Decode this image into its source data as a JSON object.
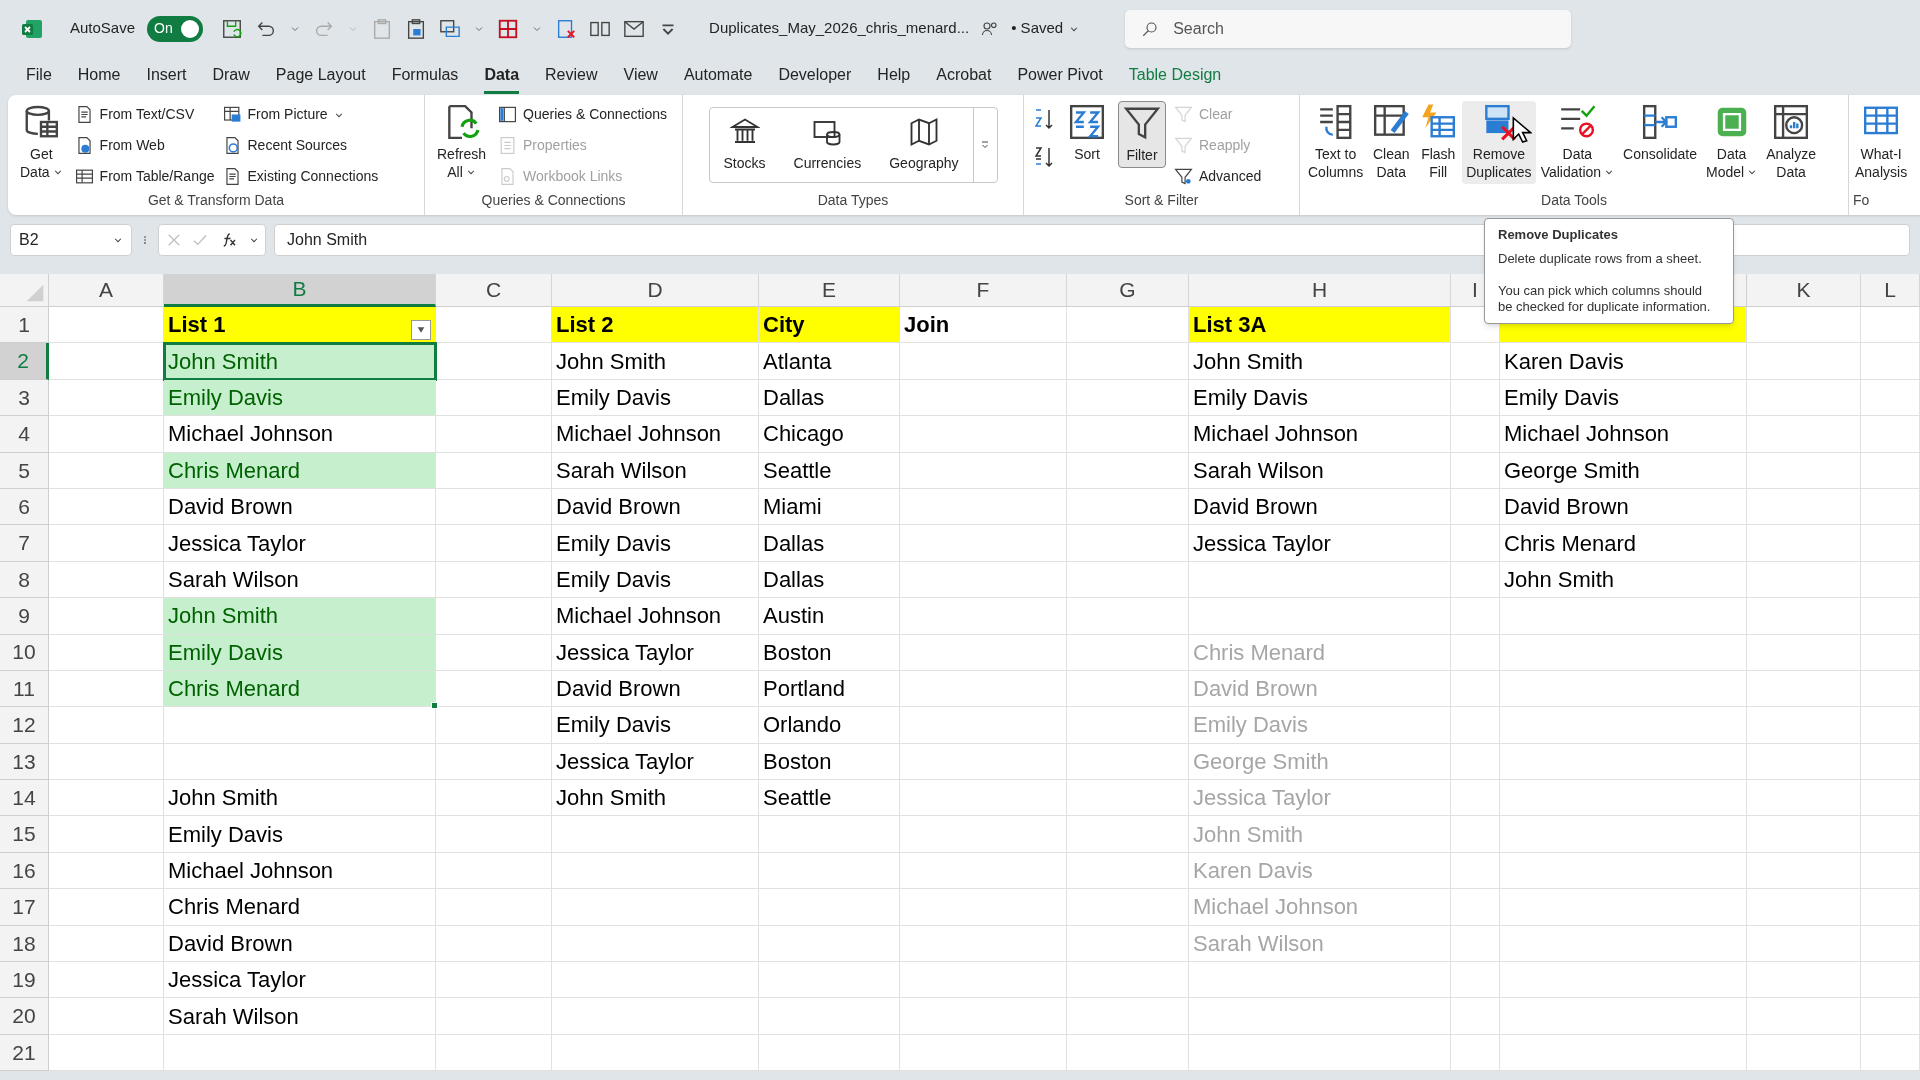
{
  "title_bar": {
    "autosave_label": "AutoSave",
    "autosave": {
      "on": true,
      "text": "On"
    },
    "filename": "Duplicates_May_2026_chris_menard...",
    "save_status": "• Saved",
    "search": {
      "placeholder": "Search"
    }
  },
  "menu_tabs": [
    {
      "label": "File",
      "selected": false,
      "kind": "normal"
    },
    {
      "label": "Home",
      "selected": false,
      "kind": "normal"
    },
    {
      "label": "Insert",
      "selected": false,
      "kind": "normal"
    },
    {
      "label": "Draw",
      "selected": false,
      "kind": "normal"
    },
    {
      "label": "Page Layout",
      "selected": false,
      "kind": "normal"
    },
    {
      "label": "Formulas",
      "selected": false,
      "kind": "normal"
    },
    {
      "label": "Data",
      "selected": true,
      "kind": "normal"
    },
    {
      "label": "Review",
      "selected": false,
      "kind": "normal"
    },
    {
      "label": "View",
      "selected": false,
      "kind": "normal"
    },
    {
      "label": "Automate",
      "selected": false,
      "kind": "normal"
    },
    {
      "label": "Developer",
      "selected": false,
      "kind": "normal"
    },
    {
      "label": "Help",
      "selected": false,
      "kind": "normal"
    },
    {
      "label": "Acrobat",
      "selected": false,
      "kind": "normal"
    },
    {
      "label": "Power Pivot",
      "selected": false,
      "kind": "normal"
    },
    {
      "label": "Table Design",
      "selected": false,
      "kind": "contextual"
    }
  ],
  "ribbon_groups": [
    {
      "label": "Get & Transform Data",
      "items": [
        {
          "kind": "large",
          "lines": [
            "Get",
            "Data"
          ],
          "dropdown": true,
          "disabled": false,
          "pressed": false
        },
        {
          "kind": "small_column",
          "items": [
            {
              "label": "From Text/CSV",
              "disabled": false,
              "dropdown": false
            },
            {
              "label": "From Web",
              "disabled": false,
              "dropdown": false
            },
            {
              "label": "From Table/Range",
              "disabled": false,
              "dropdown": false
            }
          ]
        },
        {
          "kind": "small_column",
          "items": [
            {
              "label": "From Picture",
              "disabled": false,
              "dropdown": true
            },
            {
              "label": "Recent Sources",
              "disabled": false,
              "dropdown": false
            },
            {
              "label": "Existing Connections",
              "disabled": false,
              "dropdown": false
            }
          ]
        }
      ]
    },
    {
      "label": "Queries & Connections",
      "items": [
        {
          "kind": "large",
          "lines": [
            "Refresh",
            "All"
          ],
          "dropdown": true,
          "disabled": false,
          "pressed": false
        },
        {
          "kind": "small_column",
          "items": [
            {
              "label": "Queries & Connections",
              "disabled": false,
              "dropdown": false
            },
            {
              "label": "Properties",
              "disabled": true,
              "dropdown": false
            },
            {
              "label": "Workbook Links",
              "disabled": true,
              "dropdown": false
            }
          ]
        }
      ]
    },
    {
      "label": "Data Types",
      "items": [
        {
          "kind": "gallery",
          "items": [
            {
              "label": "Stocks"
            },
            {
              "label": "Currencies"
            },
            {
              "label": "Geography"
            }
          ]
        }
      ]
    },
    {
      "label": "Sort & Filter",
      "items": [
        {
          "kind": "sort_buttons"
        },
        {
          "kind": "large",
          "lines": [
            "Sort"
          ],
          "dropdown": false,
          "disabled": false,
          "pressed": false
        },
        {
          "kind": "large",
          "lines": [
            "Filter"
          ],
          "dropdown": false,
          "disabled": false,
          "pressed": true
        },
        {
          "kind": "small_column",
          "items": [
            {
              "label": "Clear",
              "disabled": true,
              "dropdown": false
            },
            {
              "label": "Reapply",
              "disabled": true,
              "dropdown": false
            },
            {
              "label": "Advanced",
              "disabled": false,
              "dropdown": false
            }
          ]
        }
      ]
    },
    {
      "label": "Data Tools",
      "items": [
        {
          "kind": "large",
          "lines": [
            "Text to",
            "Columns"
          ],
          "dropdown": false,
          "disabled": false,
          "pressed": false
        },
        {
          "kind": "large",
          "lines": [
            "Clean",
            "Data"
          ],
          "dropdown": false,
          "disabled": false,
          "pressed": false
        },
        {
          "kind": "large",
          "lines": [
            "Flash",
            "Fill"
          ],
          "dropdown": false,
          "disabled": false,
          "pressed": false
        },
        {
          "kind": "large",
          "lines": [
            "Remove",
            "Duplicates"
          ],
          "dropdown": false,
          "disabled": false,
          "pressed": false,
          "hovered": true
        },
        {
          "kind": "large",
          "lines": [
            "Data",
            "Validation"
          ],
          "dropdown": true,
          "disabled": false,
          "pressed": false
        },
        {
          "kind": "large",
          "lines": [
            "Consolidate"
          ],
          "dropdown": false,
          "disabled": false,
          "pressed": false
        },
        {
          "kind": "large",
          "lines": [
            "Data",
            "Model"
          ],
          "dropdown": true,
          "disabled": false,
          "pressed": false
        },
        {
          "kind": "large",
          "lines": [
            "Analyze",
            "Data"
          ],
          "dropdown": false,
          "disabled": false,
          "pressed": false
        }
      ]
    },
    {
      "label": "Fo",
      "items": [
        {
          "kind": "large",
          "lines": [
            "What-I",
            "Analysis"
          ],
          "dropdown": false,
          "disabled": false,
          "pressed": false
        }
      ]
    }
  ],
  "formula_bar": {
    "name_box": "B2",
    "formula": "John Smith"
  },
  "tooltip": {
    "title": "Remove Duplicates",
    "text": "Delete duplicate rows from a sheet.",
    "detail": "You can pick which columns should be checked for duplicate information."
  },
  "sheet": {
    "columns": [
      {
        "label": "A",
        "selected": false
      },
      {
        "label": "B",
        "selected": true
      },
      {
        "label": "C",
        "selected": false
      },
      {
        "label": "D",
        "selected": false
      },
      {
        "label": "E",
        "selected": false
      },
      {
        "label": "F",
        "selected": false
      },
      {
        "label": "G",
        "selected": false
      },
      {
        "label": "H",
        "selected": false
      },
      {
        "label": "I",
        "selected": false
      },
      "",
      {
        "label": "K",
        "selected": false
      },
      {
        "label": "L",
        "selected": false
      }
    ],
    "rows": [
      {
        "number": "1",
        "selected": false,
        "cells": [
          "",
          {
            "text": "List 1",
            "kind": "header",
            "filter_button": true
          },
          "",
          {
            "text": "List 2",
            "kind": "header"
          },
          {
            "text": "City",
            "kind": "header"
          },
          {
            "text": "Join",
            "kind": "bold"
          },
          "",
          {
            "text": "List 3A",
            "kind": "header"
          },
          "",
          {
            "kind": "header"
          }
        ]
      },
      {
        "number": "2",
        "selected": true,
        "cells": [
          "",
          {
            "text": "John Smith",
            "kind": "highlight"
          },
          "",
          {
            "text": "John Smith",
            "kind": "plain"
          },
          {
            "text": "Atlanta",
            "kind": "plain"
          },
          "",
          "",
          {
            "text": "John Smith",
            "kind": "plain"
          },
          "",
          {
            "text": "Karen Davis",
            "kind": "plain"
          }
        ]
      },
      {
        "number": "3",
        "selected": false,
        "cells": [
          "",
          {
            "text": "Emily Davis",
            "kind": "highlight"
          },
          "",
          {
            "text": "Emily Davis",
            "kind": "plain"
          },
          {
            "text": "Dallas",
            "kind": "plain"
          },
          "",
          "",
          {
            "text": "Emily Davis",
            "kind": "plain"
          },
          "",
          {
            "text": "Emily Davis",
            "kind": "plain"
          }
        ]
      },
      {
        "number": "4",
        "selected": false,
        "cells": [
          "",
          {
            "text": "Michael Johnson",
            "kind": "plain"
          },
          "",
          {
            "text": "Michael Johnson",
            "kind": "plain"
          },
          {
            "text": "Chicago",
            "kind": "plain"
          },
          "",
          "",
          {
            "text": "Michael Johnson",
            "kind": "plain"
          },
          "",
          {
            "text": "Michael Johnson",
            "kind": "plain"
          }
        ]
      },
      {
        "number": "5",
        "selected": false,
        "cells": [
          "",
          {
            "text": "Chris Menard",
            "kind": "highlight"
          },
          "",
          {
            "text": "Sarah Wilson",
            "kind": "plain"
          },
          {
            "text": "Seattle",
            "kind": "plain"
          },
          "",
          "",
          {
            "text": "Sarah Wilson",
            "kind": "plain"
          },
          "",
          {
            "text": "George Smith",
            "kind": "plain"
          }
        ]
      },
      {
        "number": "6",
        "selected": false,
        "cells": [
          "",
          {
            "text": "David Brown",
            "kind": "plain"
          },
          "",
          {
            "text": "David Brown",
            "kind": "plain"
          },
          {
            "text": "Miami",
            "kind": "plain"
          },
          "",
          "",
          {
            "text": "David Brown",
            "kind": "plain"
          },
          "",
          {
            "text": "David Brown",
            "kind": "plain"
          }
        ]
      },
      {
        "number": "7",
        "selected": false,
        "cells": [
          "",
          {
            "text": "Jessica Taylor",
            "kind": "plain"
          },
          "",
          {
            "text": "Emily Davis",
            "kind": "plain"
          },
          {
            "text": "Dallas",
            "kind": "plain"
          },
          "",
          "",
          {
            "text": "Jessica Taylor",
            "kind": "plain"
          },
          "",
          {
            "text": "Chris Menard",
            "kind": "plain"
          }
        ]
      },
      {
        "number": "8",
        "selected": false,
        "cells": [
          "",
          {
            "text": "Sarah Wilson",
            "kind": "plain"
          },
          "",
          {
            "text": "Emily Davis",
            "kind": "plain"
          },
          {
            "text": "Dallas",
            "kind": "plain"
          },
          "",
          "",
          "",
          "",
          {
            "text": "John Smith",
            "kind": "plain"
          }
        ]
      },
      {
        "number": "9",
        "selected": false,
        "cells": [
          "",
          {
            "text": "John Smith",
            "kind": "highlight"
          },
          "",
          {
            "text": "Michael Johnson",
            "kind": "plain"
          },
          {
            "text": "Austin",
            "kind": "plain"
          }
        ]
      },
      {
        "number": "10",
        "selected": false,
        "cells": [
          "",
          {
            "text": "Emily Davis",
            "kind": "highlight"
          },
          "",
          {
            "text": "Jessica Taylor",
            "kind": "plain"
          },
          {
            "text": "Boston",
            "kind": "plain"
          },
          "",
          "",
          {
            "text": "Chris Menard",
            "kind": "faded"
          }
        ]
      },
      {
        "number": "11",
        "selected": false,
        "cells": [
          "",
          {
            "text": "Chris Menard",
            "kind": "highlight",
            "fill_handle": true
          },
          "",
          {
            "text": "David Brown",
            "kind": "plain"
          },
          {
            "text": "Portland",
            "kind": "plain"
          },
          "",
          "",
          {
            "text": "David Brown",
            "kind": "faded"
          }
        ]
      },
      {
        "number": "12",
        "selected": false,
        "cells": [
          "",
          "",
          "",
          {
            "text": "Emily Davis",
            "kind": "plain"
          },
          {
            "text": "Orlando",
            "kind": "plain"
          },
          "",
          "",
          {
            "text": "Emily Davis",
            "kind": "faded"
          }
        ]
      },
      {
        "number": "13",
        "selected": false,
        "cells": [
          "",
          "",
          "",
          {
            "text": "Jessica Taylor",
            "kind": "plain"
          },
          {
            "text": "Boston",
            "kind": "plain"
          },
          "",
          "",
          {
            "text": "George Smith",
            "kind": "faded"
          }
        ]
      },
      {
        "number": "14",
        "selected": false,
        "cells": [
          "",
          {
            "text": "John Smith",
            "kind": "plain"
          },
          "",
          {
            "text": "John Smith",
            "kind": "plain"
          },
          {
            "text": "Seattle",
            "kind": "plain"
          },
          "",
          "",
          {
            "text": "Jessica Taylor",
            "kind": "faded"
          }
        ]
      },
      {
        "number": "15",
        "selected": false,
        "cells": [
          "",
          {
            "text": "Emily Davis",
            "kind": "plain"
          },
          "",
          "",
          "",
          "",
          "",
          {
            "text": "John Smith",
            "kind": "faded"
          }
        ]
      },
      {
        "number": "16",
        "selected": false,
        "cells": [
          "",
          {
            "text": "Michael Johnson",
            "kind": "plain"
          },
          "",
          "",
          "",
          "",
          "",
          {
            "text": "Karen Davis",
            "kind": "faded"
          }
        ]
      },
      {
        "number": "17",
        "selected": false,
        "cells": [
          "",
          {
            "text": "Chris Menard",
            "kind": "plain"
          },
          "",
          "",
          "",
          "",
          "",
          {
            "text": "Michael Johnson",
            "kind": "faded"
          }
        ]
      },
      {
        "number": "18",
        "selected": false,
        "cells": [
          "",
          {
            "text": "David Brown",
            "kind": "plain"
          },
          "",
          "",
          "",
          "",
          "",
          {
            "text": "Sarah Wilson",
            "kind": "faded"
          }
        ]
      },
      {
        "number": "19",
        "selected": false,
        "cells": [
          "",
          {
            "text": "Jessica Taylor",
            "kind": "plain"
          }
        ]
      },
      {
        "number": "20",
        "selected": false,
        "cells": [
          "",
          {
            "text": "Sarah Wilson",
            "kind": "plain"
          }
        ]
      },
      {
        "number": "21",
        "selected": false
      }
    ]
  }
}
